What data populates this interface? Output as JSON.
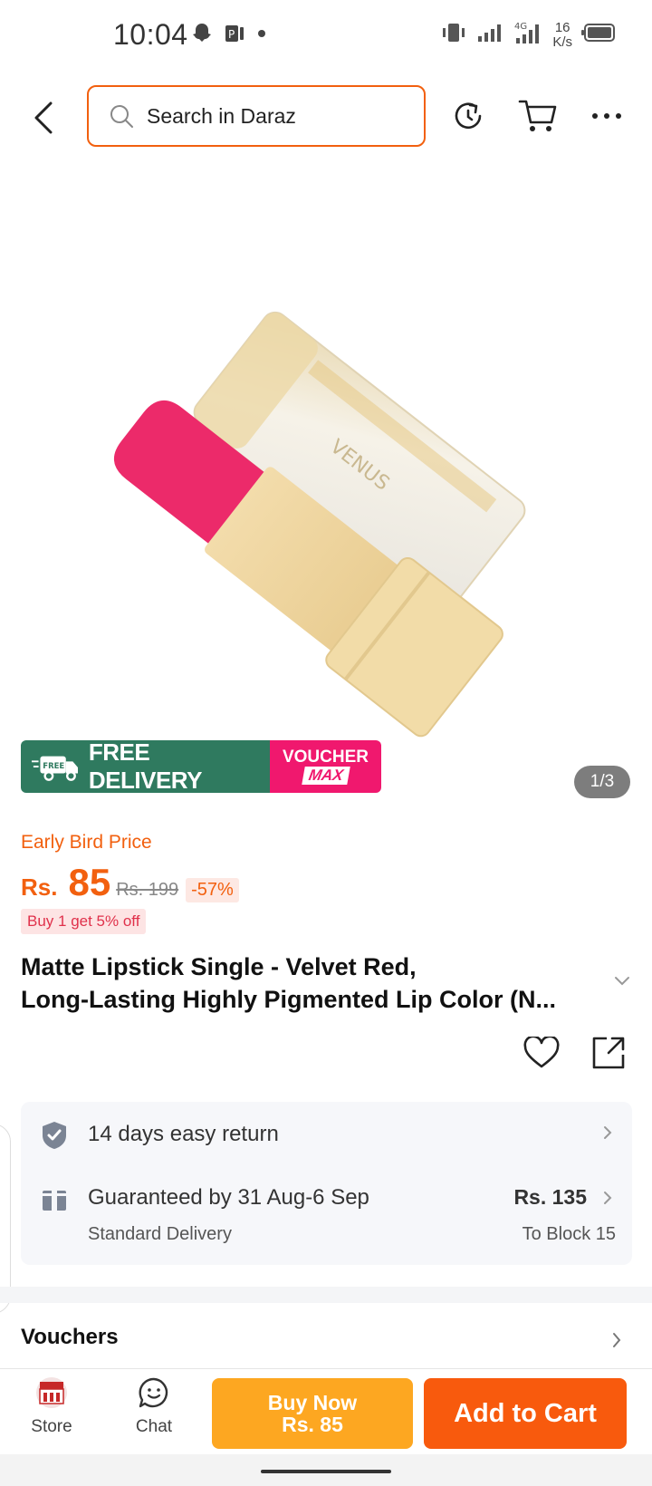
{
  "status_bar": {
    "time": "10:04",
    "net_speed_value": "16",
    "net_speed_unit": "K/s",
    "network": "4G"
  },
  "header": {
    "search_placeholder": "Search in Daraz"
  },
  "gallery": {
    "promo_free_delivery": "FREE DELIVERY",
    "promo_free_tag": "FREE",
    "promo_voucher_top": "VOUCHER",
    "promo_voucher_bottom": "MAX",
    "page_indicator": "1/3"
  },
  "pricing": {
    "early_bird_label": "Early Bird Price",
    "currency": "Rs.",
    "price": "85",
    "original_price": "Rs. 199",
    "discount": "-57%",
    "promo_tag": "Buy 1 get 5% off"
  },
  "product": {
    "title_line1": "Matte Lipstick Single - Velvet Red,",
    "title_line2": "Long-Lasting Highly Pigmented Lip Color (N..."
  },
  "delivery": {
    "return_policy": "14 days easy return",
    "guarantee": "Guaranteed by 31 Aug-6 Sep",
    "delivery_type": "Standard Delivery",
    "delivery_fee": "Rs. 135",
    "location": "To Block 15"
  },
  "vouchers": {
    "label": "Vouchers"
  },
  "bottom_bar": {
    "store_label": "Store",
    "chat_label": "Chat",
    "buy_now_label": "Buy Now",
    "buy_now_price": "Rs. 85",
    "add_to_cart_label": "Add to Cart"
  },
  "colors": {
    "brand_orange": "#f2600f",
    "buy_now": "#fda721",
    "add_to_cart": "#f85a0d",
    "free_delivery_green": "#2f7a5f",
    "voucher_pink": "#f0186e"
  }
}
